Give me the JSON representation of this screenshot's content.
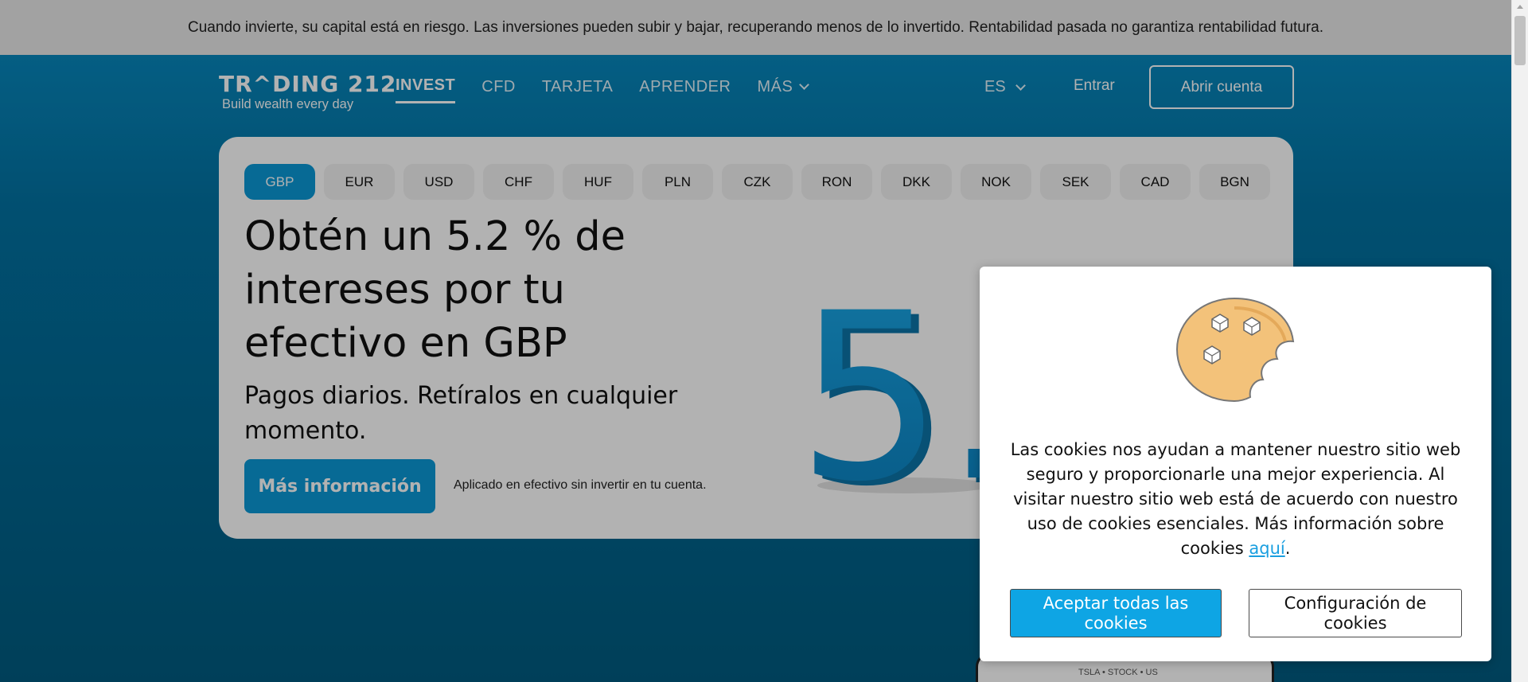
{
  "risk_banner": {
    "text": "Cuando invierte, su capital está en riesgo. Las inversiones pueden subir y bajar, recuperando menos de lo invertido. Rentabilidad pasada no garantiza rentabilidad futura."
  },
  "header": {
    "logo_title": "TR^DING 212",
    "logo_subtitle": "Build wealth every day",
    "nav": [
      {
        "label": "INVEST",
        "active": true
      },
      {
        "label": "CFD",
        "active": false
      },
      {
        "label": "TARJETA",
        "active": false
      },
      {
        "label": "APRENDER",
        "active": false
      },
      {
        "label": "MÁS",
        "active": false
      }
    ],
    "language": "ES",
    "login_label": "Entrar",
    "open_account_label": "Abrir cuenta"
  },
  "hero": {
    "currencies": [
      "GBP",
      "EUR",
      "USD",
      "CHF",
      "HUF",
      "PLN",
      "CZK",
      "RON",
      "DKK",
      "NOK",
      "SEK",
      "CAD",
      "BGN"
    ],
    "selected_currency": "GBP",
    "title": "Obtén un 5.2 % de intereses por tu efectivo en GBP",
    "subtitle": "Pagos diarios. Retíralos en cualquier momento.",
    "cta_label": "Más información",
    "note": "Aplicado en efectivo sin invertir en tu cuenta.",
    "big_number": "5.",
    "phone_caption": "TSLA • STOCK • US"
  },
  "cookie_dialog": {
    "text": "Las cookies nos ayudan a mantener nuestro sitio web seguro y proporcionarle una mejor experiencia. Al visitar nuestro sitio web está de acuerdo con nuestro uso de cookies esenciales. Más información sobre cookies ",
    "link_label": "aquí",
    "text_end": ".",
    "accept_label": "Aceptar todas las cookies",
    "config_label": "Configuración de cookies"
  },
  "colors": {
    "brand_blue": "#0b99d6",
    "background_blue": "#0272a2",
    "link_blue": "#1a9fe0"
  }
}
